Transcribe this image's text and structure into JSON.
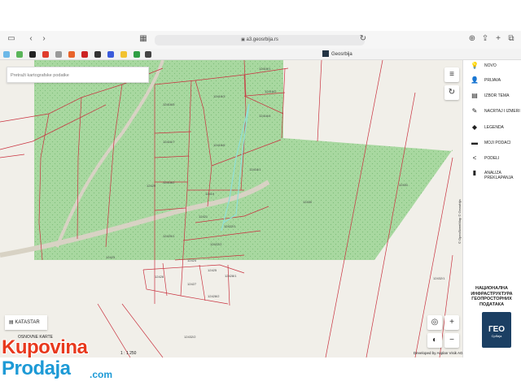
{
  "browser": {
    "url": "a3.geosrbija.rs",
    "tab_title": "Geosrbija"
  },
  "search": {
    "placeholder": "Pretraži kartografske podatke"
  },
  "map_controls": {
    "layers_icon": "menu-icon",
    "refresh_icon": "refresh-icon"
  },
  "right_menu": {
    "items": [
      {
        "label": "NOVO",
        "icon": "lightbulb-icon"
      },
      {
        "label": "PRIJAVA",
        "icon": "user-icon"
      },
      {
        "label": "IZBOR TEMA",
        "icon": "layers-icon"
      },
      {
        "label": "NACRTAJ I IZMERI",
        "icon": "pencil-icon"
      },
      {
        "label": "LEGENDA",
        "icon": "legend-icon"
      },
      {
        "label": "MOJI PODACI",
        "icon": "folder-icon"
      },
      {
        "label": "PODELI",
        "icon": "share-icon"
      },
      {
        "label": "ANALIZA PREKLAPANJA",
        "icon": "analysis-icon"
      }
    ],
    "agency_name": [
      "НАЦИОНАЛНА",
      "ИНФРАСТРУКТУРА",
      "ГЕОПРОСТОРНИХ",
      "ПОДАТАКА"
    ],
    "logo_text": "ГЕО",
    "logo_sub": "Србија"
  },
  "bottom_controls": {
    "katastar_label": "KATASTAR",
    "osnovne_label": "OSNOVNE KARTE",
    "scale": "1 : 1 250",
    "attribution": "Developed by Asplan Visik AG",
    "side_attribution": "© OpenStreetMap © Geosrbija"
  },
  "parcels": [
    "12416/1",
    "12416/2",
    "12416/3",
    "12416/4",
    "12416/5",
    "12416/6",
    "12416/7",
    "12418/1",
    "12418/2",
    "12419",
    "12420/1",
    "12421",
    "12422/1",
    "12422/2",
    "12423",
    "12424",
    "12425",
    "12426",
    "12427",
    "12428/1",
    "12428/2",
    "12429",
    "12430",
    "12431",
    "12432/1",
    "12432/2"
  ],
  "watermark": {
    "line1": "Kupovina",
    "line2": "Prodaja",
    "suffix": ".com"
  },
  "colors": {
    "forest": "#a8d8a0",
    "map_bg": "#f1efe9",
    "parcel_line": "#c9323f",
    "panel_logo": "#1b3f63",
    "wm_red": "#e8391d",
    "wm_blue": "#1d9ad6"
  }
}
